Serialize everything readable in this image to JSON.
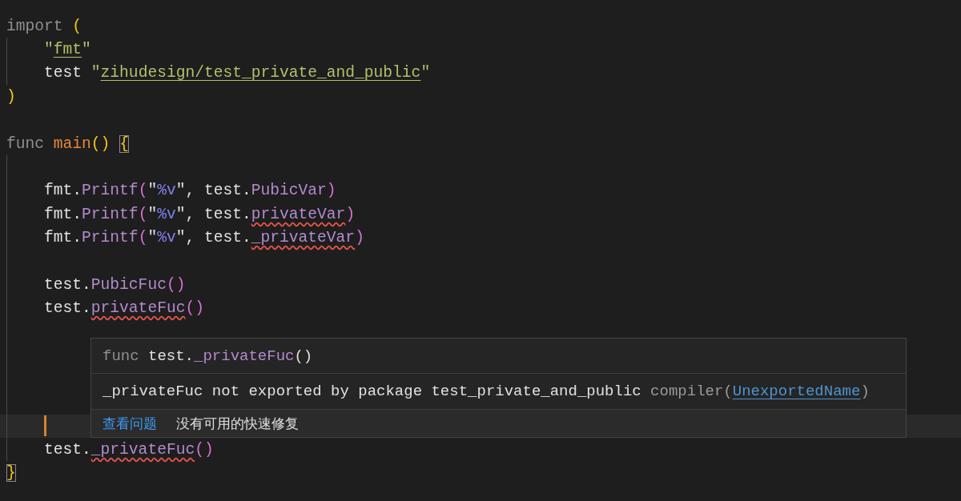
{
  "lines": [
    {
      "indent": false,
      "tokens": [
        {
          "text": "import ",
          "kind": "keyword"
        },
        {
          "text": "(",
          "kind": "bracket"
        }
      ]
    },
    {
      "indent": true,
      "tokens": [
        {
          "text": "\"",
          "kind": "string"
        },
        {
          "text": "fmt",
          "kind": "path"
        },
        {
          "text": "\"",
          "kind": "string"
        }
      ]
    },
    {
      "indent": true,
      "tokens": [
        {
          "text": "test ",
          "kind": "plain"
        },
        {
          "text": "\"",
          "kind": "string"
        },
        {
          "text": "zihudesign/test_private_and_public",
          "kind": "path"
        },
        {
          "text": "\"",
          "kind": "string"
        }
      ]
    },
    {
      "indent": false,
      "tokens": [
        {
          "text": ")",
          "kind": "bracket"
        }
      ]
    },
    {
      "indent": false
    },
    {
      "indent": false,
      "tokens": [
        {
          "text": "func ",
          "kind": "keyword"
        },
        {
          "text": "main",
          "kind": "function"
        },
        {
          "text": "() ",
          "kind": "bracket"
        },
        {
          "text": "{",
          "kind": "bracket",
          "matched": true
        }
      ]
    },
    {
      "indent": true
    },
    {
      "indent": true,
      "tokens": [
        {
          "text": "fmt.",
          "kind": "plain"
        },
        {
          "text": "Printf",
          "kind": "method"
        },
        {
          "text": "(",
          "kind": "call"
        },
        {
          "text": "\"",
          "kind": "plain"
        },
        {
          "text": "%v",
          "kind": "format"
        },
        {
          "text": "\", test.",
          "kind": "plain"
        },
        {
          "text": "PubicVar",
          "kind": "field"
        },
        {
          "text": ")",
          "kind": "call"
        }
      ]
    },
    {
      "indent": true,
      "tokens": [
        {
          "text": "fmt.",
          "kind": "plain"
        },
        {
          "text": "Printf",
          "kind": "method"
        },
        {
          "text": "(",
          "kind": "call"
        },
        {
          "text": "\"",
          "kind": "plain"
        },
        {
          "text": "%v",
          "kind": "format"
        },
        {
          "text": "\", test.",
          "kind": "plain"
        },
        {
          "text": "privateVar",
          "kind": "field",
          "error": true
        },
        {
          "text": ")",
          "kind": "call"
        }
      ]
    },
    {
      "indent": true,
      "tokens": [
        {
          "text": "fmt.",
          "kind": "plain"
        },
        {
          "text": "Printf",
          "kind": "method"
        },
        {
          "text": "(",
          "kind": "call"
        },
        {
          "text": "\"",
          "kind": "plain"
        },
        {
          "text": "%v",
          "kind": "format"
        },
        {
          "text": "\", test.",
          "kind": "plain"
        },
        {
          "text": "_privateVar",
          "kind": "field",
          "error": true
        },
        {
          "text": ")",
          "kind": "call"
        }
      ]
    },
    {
      "indent": true
    },
    {
      "indent": true,
      "tokens": [
        {
          "text": "test.",
          "kind": "plain"
        },
        {
          "text": "PubicFuc",
          "kind": "method"
        },
        {
          "text": "()",
          "kind": "call"
        }
      ]
    },
    {
      "indent": true,
      "tokens": [
        {
          "text": "test.",
          "kind": "plain"
        },
        {
          "text": "privateFuc",
          "kind": "method",
          "error": true
        },
        {
          "text": "()",
          "kind": "call"
        }
      ]
    },
    {
      "indent": true
    },
    {
      "indent": true
    },
    {
      "indent": true
    },
    {
      "indent": true
    },
    {
      "indent": true,
      "current": true
    },
    {
      "indent": true,
      "tokens": [
        {
          "text": "test.",
          "kind": "plain"
        },
        {
          "text": "_privateFuc",
          "kind": "method",
          "error": true
        },
        {
          "text": "()",
          "kind": "call"
        }
      ]
    },
    {
      "indent": false,
      "tokens": [
        {
          "text": "}",
          "kind": "bracket",
          "matched": true
        }
      ]
    }
  ],
  "hover": {
    "signature": [
      {
        "text": "func ",
        "kind": "keyword"
      },
      {
        "text": "test.",
        "kind": "plain"
      },
      {
        "text": "_privateFuc",
        "kind": "method"
      },
      {
        "text": "()",
        "kind": "plain"
      }
    ],
    "message": "_privateFuc not exported by package test_private_and_public",
    "source": "compiler(",
    "code": "UnexportedName",
    "source_end": ")",
    "actions": [
      {
        "label": "查看问题",
        "kind": "link"
      },
      {
        "label": "没有可用的快速修复",
        "kind": "note"
      }
    ]
  }
}
